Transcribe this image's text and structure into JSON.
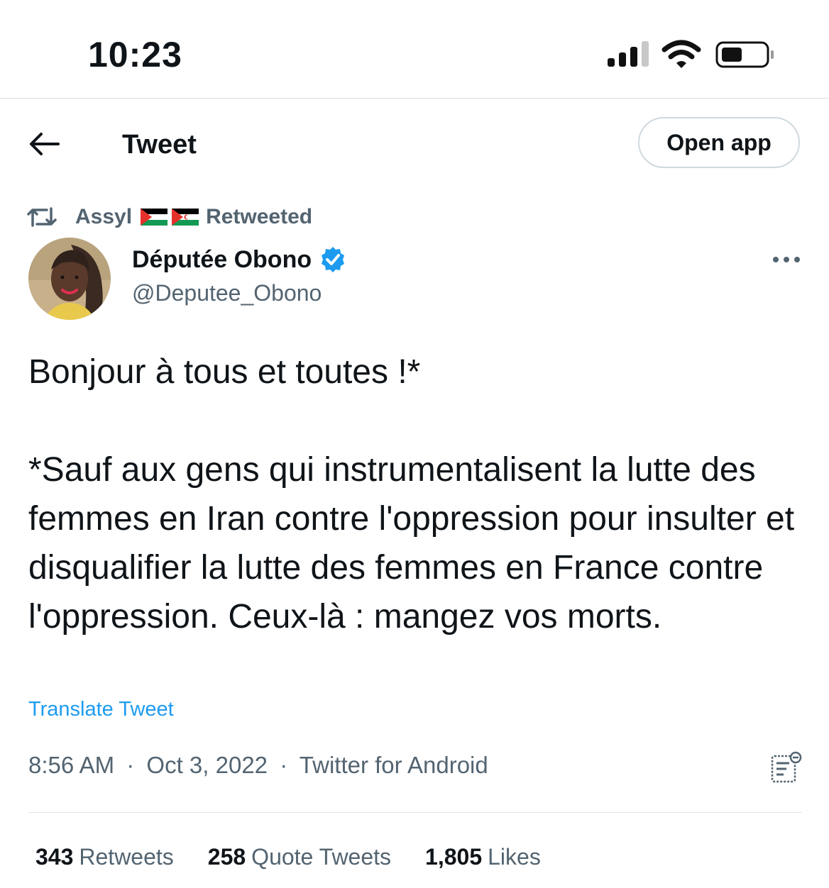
{
  "status_bar": {
    "time": "10:23"
  },
  "header": {
    "title": "Tweet",
    "open_app_label": "Open app"
  },
  "retweet_context": {
    "name": "Assyl",
    "suffix": "Retweeted",
    "flags": [
      "palestine-flag",
      "western-sahara-flag"
    ]
  },
  "author": {
    "display_name": "Députée Obono",
    "handle": "@Deputee_Obono",
    "verified": true
  },
  "tweet": {
    "line_1": "Bonjour à tous et toutes !*",
    "line_2": "*Sauf aux gens qui instrumentalisent la lutte des femmes en Iran contre l'oppression pour insulter et disqualifier la lutte des femmes en France contre l'oppression. Ceux-là : mangez vos morts.",
    "translate_label": "Translate Tweet"
  },
  "meta": {
    "time": "8:56 AM",
    "date": "Oct 3, 2022",
    "source": "Twitter for Android",
    "separator": "·"
  },
  "stats": {
    "retweets_count": "343",
    "retweets_label": "Retweets",
    "quote_count": "258",
    "quote_label": "Quote Tweets",
    "likes_count": "1,805",
    "likes_label": "Likes"
  },
  "colors": {
    "text": "#0f1419",
    "secondary": "#536471",
    "link": "#1d9bf0",
    "border": "#cfd9de"
  },
  "icons": {
    "back": "arrow-left-icon",
    "retweet": "retweet-icon",
    "verified": "verified-badge-icon",
    "more": "more-horizontal-icon",
    "analytics": "analytics-icon"
  }
}
